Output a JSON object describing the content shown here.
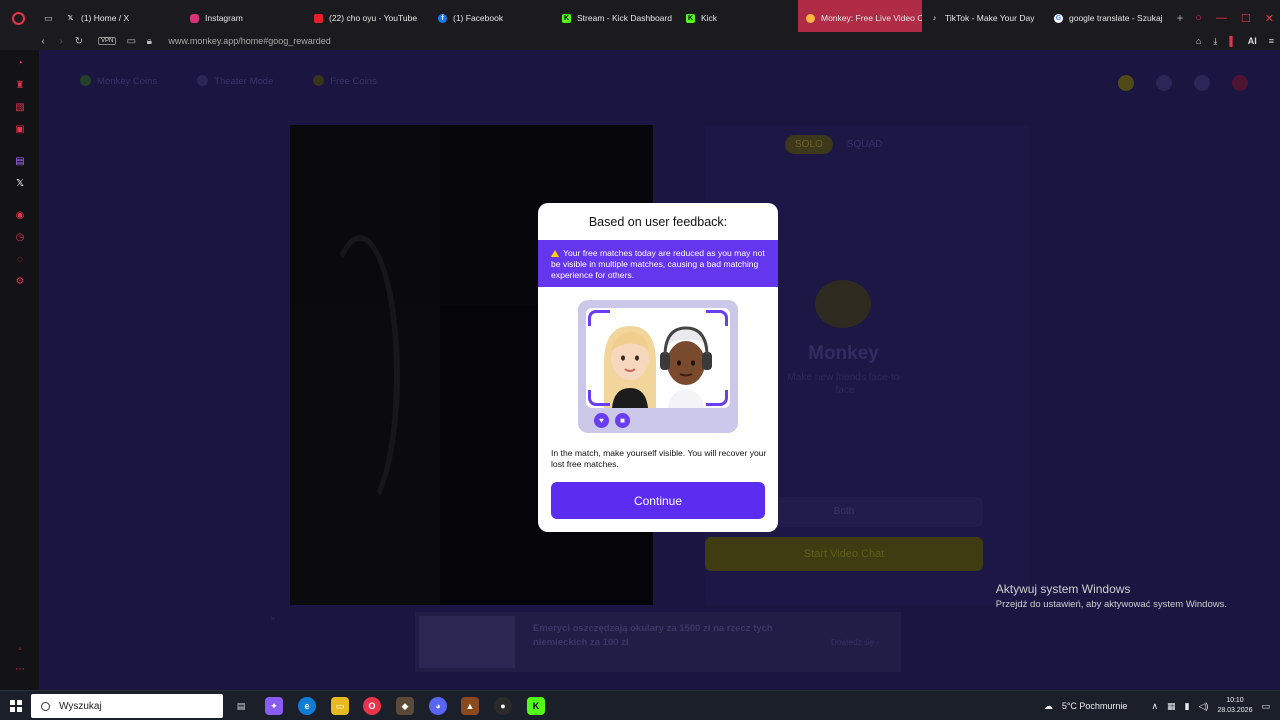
{
  "browser": {
    "tabs": [
      {
        "label": "(1) Home / X",
        "icon": "x-icon"
      },
      {
        "label": "Instagram",
        "icon": "instagram-icon"
      },
      {
        "label": "(22) cho oyu - YouTube",
        "icon": "youtube-icon"
      },
      {
        "label": "(1) Facebook",
        "icon": "facebook-icon"
      },
      {
        "label": "Stream - Kick Dashboard",
        "icon": "kick-icon"
      },
      {
        "label": "Kick",
        "icon": "kick-icon"
      },
      {
        "label": "Monkey: Free Live Video C",
        "icon": "monkey-icon",
        "active": true
      },
      {
        "label": "TikTok - Make Your Day",
        "icon": "tiktok-icon"
      },
      {
        "label": "google translate - Szukaj",
        "icon": "google-icon"
      }
    ],
    "vpn_label": "VPN",
    "url": "www.monkey.app/home#goog_rewarded",
    "ai_label": "AI",
    "accent_color": "#e8344b"
  },
  "page": {
    "nav": [
      "Monkey Coins",
      "Theater Mode",
      "Free Coins"
    ],
    "modes": {
      "solo": "SOLO",
      "squad": "SQUAD"
    },
    "brand": "Monkey",
    "tagline": "Make new friends face-to-face",
    "gender_button": "Both",
    "start_button": "Start Video Chat",
    "ad": {
      "text": "Emeryci oszczędzają okulary za 1500 zł na rzecz tych niemieckich za 100 zł",
      "more": "Dowiedz się ›",
      "close": "✕"
    }
  },
  "modal": {
    "title": "Based on user feedback:",
    "warning": "Your free matches today are reduced as you may not be visible in multiple matches, causing a bad matching experience for others.",
    "body": "In the match, make yourself visible. You will recover your lost free matches.",
    "continue_label": "Continue",
    "accent_color": "#6436ee"
  },
  "watermark": {
    "title": "Aktywuj system Windows",
    "subtitle": "Przejdź do ustawień, aby aktywować system Windows."
  },
  "taskbar": {
    "search_placeholder": "Wyszukaj",
    "weather": "5°C  Pochmurnie",
    "time": "10:10",
    "date": "28.03.2026"
  }
}
